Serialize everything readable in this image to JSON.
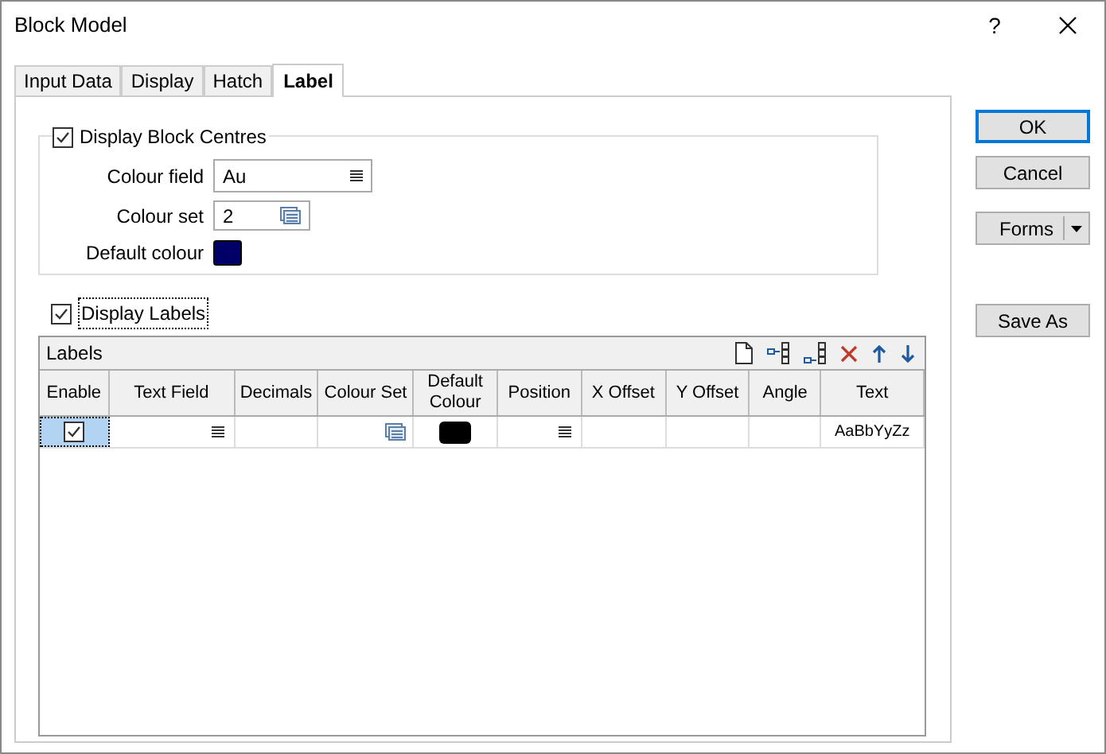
{
  "window": {
    "title": "Block Model",
    "help": "?"
  },
  "tabs": [
    {
      "label": "Input Data",
      "selected": false
    },
    {
      "label": "Display",
      "selected": false
    },
    {
      "label": "Hatch",
      "selected": false
    },
    {
      "label": "Label",
      "selected": true
    }
  ],
  "block_centres": {
    "label": "Display Block Centres",
    "checked": true,
    "colour_field": {
      "label": "Colour field",
      "value": "Au"
    },
    "colour_set": {
      "label": "Colour set",
      "value": "2"
    },
    "default_colour": {
      "label": "Default colour",
      "color": "#000066"
    }
  },
  "display_labels": {
    "label": "Display Labels",
    "checked": true
  },
  "labels_table": {
    "title": "Labels",
    "columns": [
      {
        "label": "Enable",
        "kind": "check"
      },
      {
        "label": "Text Field",
        "kind": "list"
      },
      {
        "label": "Decimals",
        "kind": "text"
      },
      {
        "label": "Colour Set",
        "kind": "set"
      },
      {
        "label": "Default Colour",
        "kind": "colour"
      },
      {
        "label": "Position",
        "kind": "list"
      },
      {
        "label": "X Offset",
        "kind": "text"
      },
      {
        "label": "Y Offset",
        "kind": "text"
      },
      {
        "label": "Angle",
        "kind": "text"
      },
      {
        "label": "Text",
        "kind": "text"
      }
    ],
    "rows": [
      {
        "selected": true,
        "enabled": true,
        "color": "#000000",
        "text": "AaBbYyZz"
      }
    ]
  },
  "buttons": [
    {
      "label": "OK",
      "kind": "default"
    },
    {
      "label": "Cancel",
      "kind": "plain"
    },
    {
      "label": "Forms",
      "kind": "split"
    },
    {
      "label": "Save As",
      "kind": "plain"
    }
  ]
}
